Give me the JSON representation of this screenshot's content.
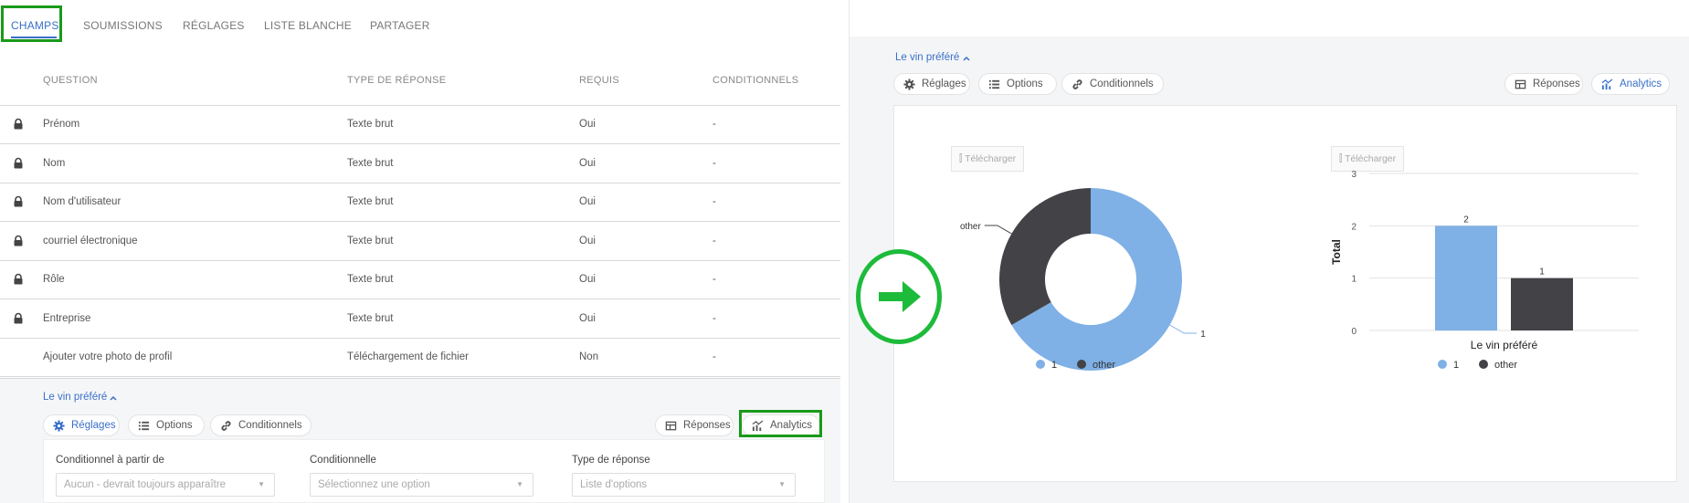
{
  "tabs": [
    "CHAMPS",
    "SOUMISSIONS",
    "RÉGLAGES",
    "LISTE BLANCHE",
    "PARTAGER"
  ],
  "table": {
    "headers": [
      "QUESTION",
      "TYPE DE RÉPONSE",
      "REQUIS",
      "CONDITIONNELS"
    ],
    "rows": [
      {
        "question": "Prénom",
        "type": "Texte brut",
        "required": "Oui",
        "cond": "-",
        "locked": true
      },
      {
        "question": "Nom",
        "type": "Texte brut",
        "required": "Oui",
        "cond": "-",
        "locked": true
      },
      {
        "question": "Nom d'utilisateur",
        "type": "Texte brut",
        "required": "Oui",
        "cond": "-",
        "locked": true
      },
      {
        "question": "courriel électronique",
        "type": "Texte brut",
        "required": "Oui",
        "cond": "-",
        "locked": true
      },
      {
        "question": "Rôle",
        "type": "Texte brut",
        "required": "Oui",
        "cond": "-",
        "locked": true
      },
      {
        "question": "Entreprise",
        "type": "Texte brut",
        "required": "Oui",
        "cond": "-",
        "locked": true
      },
      {
        "question": "Ajouter votre photo de profil",
        "type": "Téléchargement de fichier",
        "required": "Non",
        "cond": "-",
        "locked": false
      }
    ]
  },
  "field": {
    "title": "Le vin préféré",
    "pills": {
      "settings": "Réglages",
      "options": "Options",
      "conditionals": "Conditionnels",
      "responses": "Réponses",
      "analytics": "Analytics"
    }
  },
  "form": {
    "labels": [
      "Conditionnel à partir de",
      "Conditionnelle",
      "Type de réponse"
    ],
    "values": [
      "Aucun - devrait toujours apparaître",
      "Sélectionnez une option",
      "Liste d'options"
    ]
  },
  "analytics": {
    "download_label": "Télécharger",
    "colors": {
      "blue": "#7fb0e6",
      "dark": "#434347"
    }
  },
  "chart_data": [
    {
      "type": "pie",
      "labels": [
        "1",
        "other"
      ],
      "values": [
        2,
        1
      ],
      "legend": "bottom"
    },
    {
      "type": "bar",
      "categories": [
        "1",
        "other"
      ],
      "values": [
        2,
        1
      ],
      "xlabel": "Le vin préféré",
      "ylabel": "Total",
      "ylim": [
        0,
        3
      ],
      "yticks": [
        "0",
        "1",
        "2",
        "3"
      ],
      "legend": "bottom"
    }
  ]
}
